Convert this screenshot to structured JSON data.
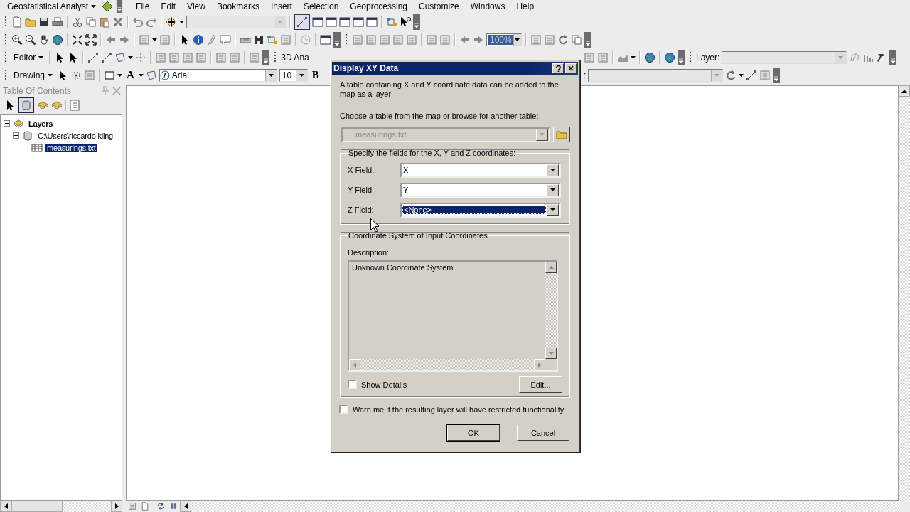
{
  "menubar": {
    "toolbar_menu": "Geostatistical Analyst",
    "items": [
      "File",
      "Edit",
      "View",
      "Bookmarks",
      "Insert",
      "Selection",
      "Geoprocessing",
      "Customize",
      "Windows",
      "Help"
    ]
  },
  "toolbars": {
    "map_scale": "100%",
    "editor": "Editor",
    "analyst_3d": "3D Ana",
    "layer_label": "Layer:",
    "drawing": "Drawing",
    "text_tool": "A",
    "font": "Arial",
    "font_size": "10",
    "bold": "B",
    "cut_label": ":"
  },
  "toc": {
    "title": "Table Of Contents",
    "tree": [
      {
        "label": "Layers",
        "kind": "frame",
        "expanded": true,
        "selected": false,
        "children": [
          {
            "label": "C:\\Users\\riccardo kling",
            "kind": "folder",
            "expanded": true,
            "selected": false,
            "children": [
              {
                "label": "measurings.txt",
                "kind": "table",
                "selected": true
              }
            ]
          }
        ]
      }
    ]
  },
  "dialog": {
    "title": "Display XY Data",
    "intro": "A table containing X and Y coordinate data can be added to the map as a layer",
    "table_prompt": "Choose a table from the map or browse for another table:",
    "table": {
      "value": "measurings.txt",
      "disabled": true
    },
    "fields_group": "Specify the fields for the X, Y and Z coordinates:",
    "fields": [
      {
        "label": "X Field:",
        "value": "X",
        "selected": false
      },
      {
        "label": "Y Field:",
        "value": "Y",
        "selected": false
      },
      {
        "label": "Z Field:",
        "value": "<None>",
        "selected": true
      }
    ],
    "coord_group": "Coordinate System of Input Coordinates",
    "description_label": "Description:",
    "description": "Unknown Coordinate System",
    "show_details": {
      "label": "Show Details",
      "checked": false
    },
    "edit_button": "Edit...",
    "warn": {
      "label": "Warn me if the resulting layer will have restricted functionality",
      "checked": false
    },
    "buttons": [
      {
        "label": "OK",
        "default": true
      },
      {
        "label": "Cancel",
        "default": false
      }
    ]
  }
}
